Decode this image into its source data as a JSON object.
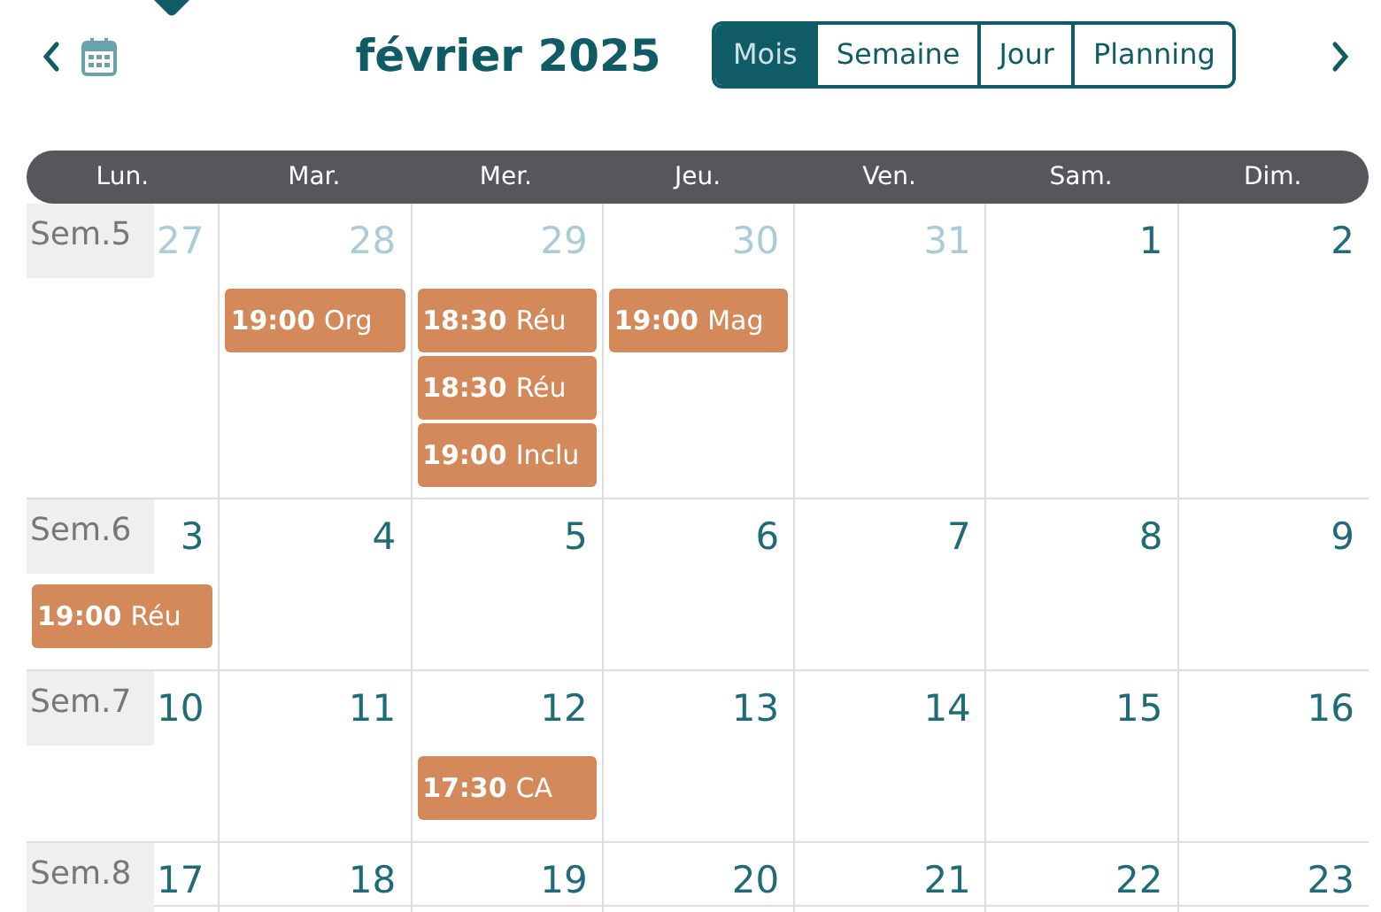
{
  "title": "février 2025",
  "views": [
    {
      "label": "Mois",
      "selected": true
    },
    {
      "label": "Semaine",
      "selected": false
    },
    {
      "label": "Jour",
      "selected": false
    },
    {
      "label": "Planning",
      "selected": false
    }
  ],
  "weekdays": [
    "Lun.",
    "Mar.",
    "Mer.",
    "Jeu.",
    "Ven.",
    "Sam.",
    "Dim."
  ],
  "weeks": [
    {
      "label": "Sem.5",
      "days": [
        {
          "day": "27",
          "outside": true
        },
        {
          "day": "28",
          "outside": true,
          "events": [
            {
              "time": "19:00",
              "title": "Org"
            }
          ]
        },
        {
          "day": "29",
          "outside": true,
          "events": [
            {
              "time": "18:30",
              "title": "Réu"
            },
            {
              "time": "18:30",
              "title": "Réu"
            },
            {
              "time": "19:00",
              "title": "Inclu"
            }
          ]
        },
        {
          "day": "30",
          "outside": true,
          "events": [
            {
              "time": "19:00",
              "title": "Mag"
            }
          ]
        },
        {
          "day": "31",
          "outside": true
        },
        {
          "day": "1",
          "outside": false
        },
        {
          "day": "2",
          "outside": false
        }
      ]
    },
    {
      "label": "Sem.6",
      "days": [
        {
          "day": "3",
          "outside": false,
          "events": [
            {
              "time": "19:00",
              "title": "Réu"
            }
          ]
        },
        {
          "day": "4",
          "outside": false
        },
        {
          "day": "5",
          "outside": false
        },
        {
          "day": "6",
          "outside": false
        },
        {
          "day": "7",
          "outside": false
        },
        {
          "day": "8",
          "outside": false
        },
        {
          "day": "9",
          "outside": false
        }
      ]
    },
    {
      "label": "Sem.7",
      "days": [
        {
          "day": "10",
          "outside": false
        },
        {
          "day": "11",
          "outside": false
        },
        {
          "day": "12",
          "outside": false,
          "events": [
            {
              "time": "17:30",
              "title": "CA"
            }
          ]
        },
        {
          "day": "13",
          "outside": false
        },
        {
          "day": "14",
          "outside": false
        },
        {
          "day": "15",
          "outside": false
        },
        {
          "day": "16",
          "outside": false
        }
      ]
    },
    {
      "label": "Sem.8",
      "days": [
        {
          "day": "17",
          "outside": false
        },
        {
          "day": "18",
          "outside": false
        },
        {
          "day": "19",
          "outside": false
        },
        {
          "day": "20",
          "outside": false
        },
        {
          "day": "21",
          "outside": false
        },
        {
          "day": "22",
          "outside": false
        },
        {
          "day": "23",
          "outside": false
        }
      ]
    }
  ]
}
